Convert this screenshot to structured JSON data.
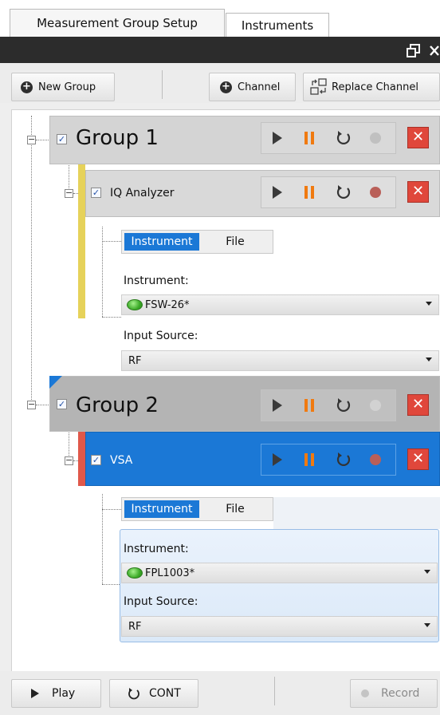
{
  "tabs": [
    {
      "label": "Measurement Group Setup",
      "active": true
    },
    {
      "label": "Instruments",
      "active": false
    }
  ],
  "window": {
    "restore_icon": "restore-icon",
    "close_icon": "close-icon"
  },
  "toolbar": {
    "new_group_label": "New Group",
    "channel_label": "Channel",
    "replace_channel_label": "Replace Channel"
  },
  "groups": [
    {
      "title": "Group 1",
      "checked": true,
      "channel": {
        "name": "IQ Analyzer",
        "checked": true,
        "color_marker": "#e6d25a",
        "selected": false,
        "source_tabs": [
          "Instrument",
          "File"
        ],
        "instrument_label": "Instrument:",
        "instrument_value": "FSW-26*",
        "input_source_label": "Input Source:",
        "input_source_value": "RF"
      }
    },
    {
      "title": "Group 2",
      "checked": true,
      "channel": {
        "name": "VSA",
        "checked": true,
        "color_marker": "#e0584a",
        "selected": true,
        "source_tabs": [
          "Instrument",
          "File"
        ],
        "instrument_label": "Instrument:",
        "instrument_value": "FPL1003*",
        "input_source_label": "Input Source:",
        "input_source_value": "RF"
      }
    }
  ],
  "bottom": {
    "play_label": "Play",
    "cont_label": "CONT",
    "record_label": "Record"
  },
  "colors": {
    "accent": "#1b78d6",
    "pause": "#f07a10",
    "close": "#e0473b",
    "record_g1": "#c0c0c0",
    "record_ch1": "#b95f58"
  }
}
